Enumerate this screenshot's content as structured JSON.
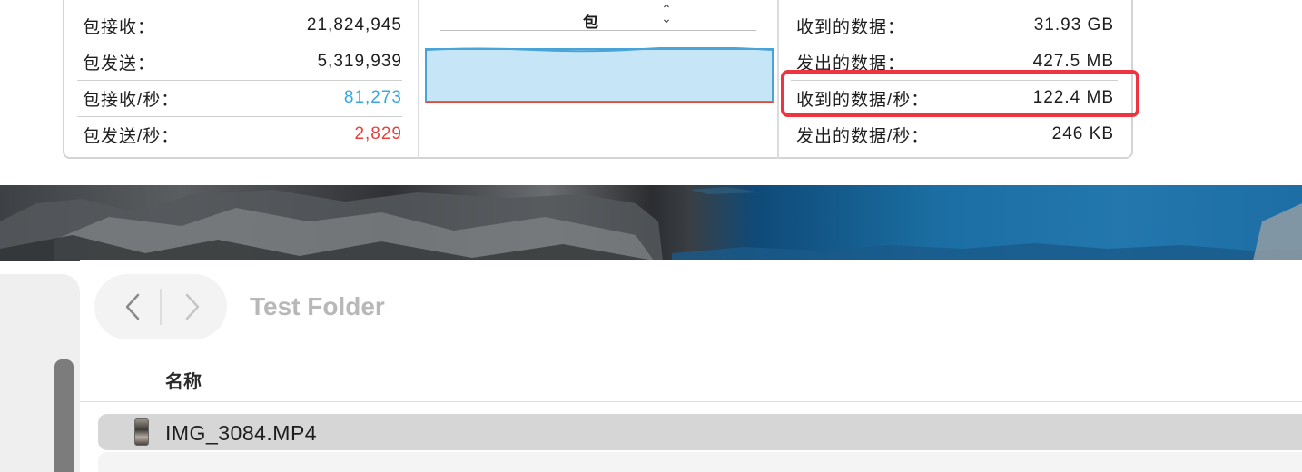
{
  "network": {
    "left_stats": [
      {
        "label": "包接收：",
        "value": "21,824,945"
      },
      {
        "label": "包发送：",
        "value": "5,319,939"
      },
      {
        "label": "包接收/秒：",
        "value": "81,273"
      },
      {
        "label": "包发送/秒：",
        "value": "2,829"
      }
    ],
    "right_stats": [
      {
        "label": "收到的数据：",
        "value": "31.93 GB"
      },
      {
        "label": "发出的数据：",
        "value": "427.5 MB"
      },
      {
        "label": "收到的数据/秒：",
        "value": "122.4 MB"
      },
      {
        "label": "发出的数据/秒：",
        "value": "246 KB"
      }
    ],
    "graph_selector": "包",
    "colors": {
      "received": "#35a9dd",
      "sent": "#e8413a",
      "highlight": "#ef3340"
    }
  },
  "finder": {
    "folder_title": "Test Folder",
    "column_name": "名称",
    "files": [
      {
        "name": "IMG_3084.MP4",
        "icon": "video-thumbnail-icon"
      }
    ]
  }
}
